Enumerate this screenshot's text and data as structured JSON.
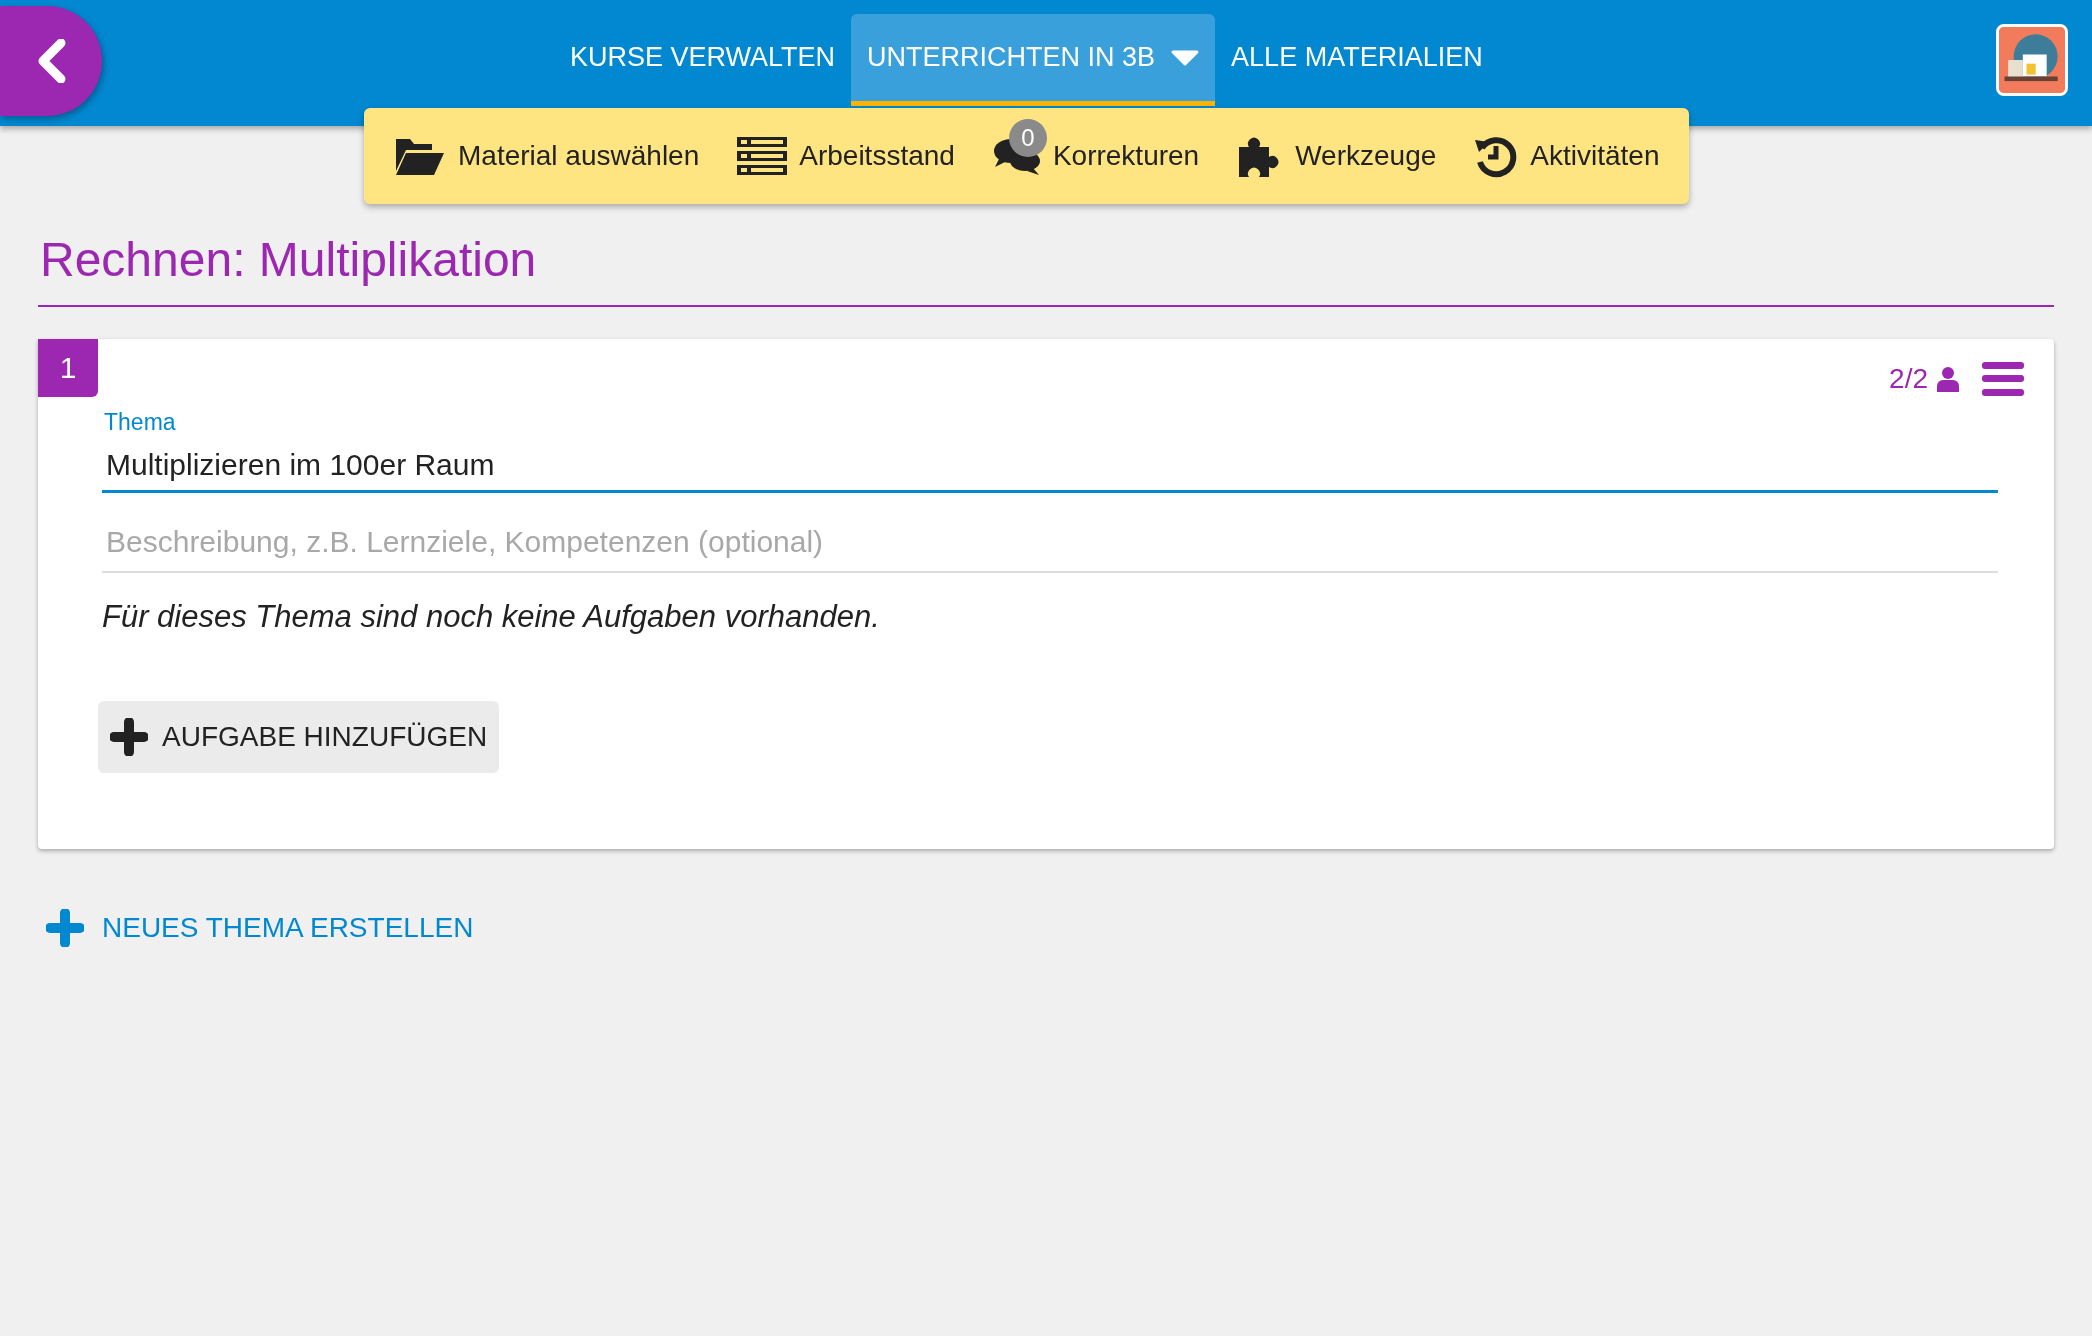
{
  "header": {
    "tabs": [
      {
        "label": "KURSE VERWALTEN",
        "selected": false,
        "dropdown": false
      },
      {
        "label": "UNTERRICHTEN IN 3B",
        "selected": true,
        "dropdown": true
      },
      {
        "label": "ALLE MATERIALIEN",
        "selected": false,
        "dropdown": false
      }
    ]
  },
  "toolbar": [
    {
      "label": "Material auswählen"
    },
    {
      "label": "Arbeitsstand"
    },
    {
      "label": "Korrekturen",
      "badge": "0"
    },
    {
      "label": "Werkzeuge"
    },
    {
      "label": "Aktivitäten"
    }
  ],
  "page_title": "Rechnen: Multiplikation",
  "topics": [
    {
      "number": "1",
      "participants": "2/2",
      "topic_label": "Thema",
      "topic_value": "Multiplizieren im 100er Raum",
      "description_placeholder": "Beschreibung, z.B. Lernziele, Kompetenzen (optional)",
      "empty_note": "Für dieses Thema sind noch keine Aufgaben vorhanden.",
      "add_task_button": "AUFGABE HINZUFÜGEN"
    }
  ],
  "new_topic_link": "NEUES THEMA ERSTELLEN"
}
